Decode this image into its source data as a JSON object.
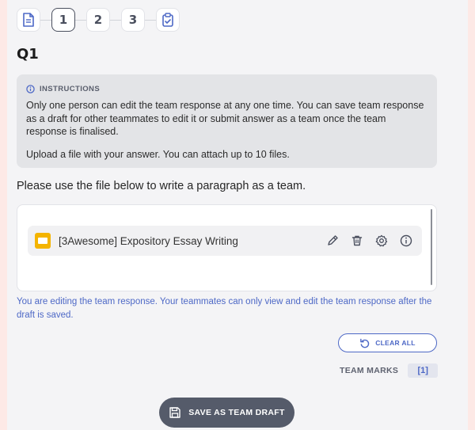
{
  "stepper": {
    "steps": [
      {
        "icon": "document-icon"
      },
      {
        "label": "1",
        "active": true
      },
      {
        "label": "2"
      },
      {
        "label": "3"
      },
      {
        "icon": "clipboard-check-icon"
      }
    ]
  },
  "question": {
    "title": "Q1"
  },
  "instructions": {
    "heading": "INSTRUCTIONS",
    "paragraph1": "Only one person can edit the team response at any one time. You can save team response as a draft for other teammates to edit it or submit answer as a team once the team response is finalised.",
    "paragraph2": "Upload a file with your answer. You can attach up to 10 files."
  },
  "prompt": "Please use the file below to write a paragraph as a team.",
  "file": {
    "name": "[3Awesome] Expository Essay Writing",
    "icon": "slides-file-icon",
    "actions": [
      "edit-icon",
      "trash-icon",
      "settings-icon",
      "info-icon"
    ]
  },
  "notice": "You are editing the team response. Your teammates can only view and edit the team response after the draft is saved.",
  "clear_all": {
    "label": "CLEAR ALL"
  },
  "team_marks": {
    "label": "TEAM MARKS",
    "value": "[1]"
  },
  "save_draft": {
    "label": "SAVE AS TEAM DRAFT"
  },
  "colors": {
    "accent": "#4d68c6",
    "dark_button": "#555b6a",
    "file_icon": "#f4b400"
  }
}
